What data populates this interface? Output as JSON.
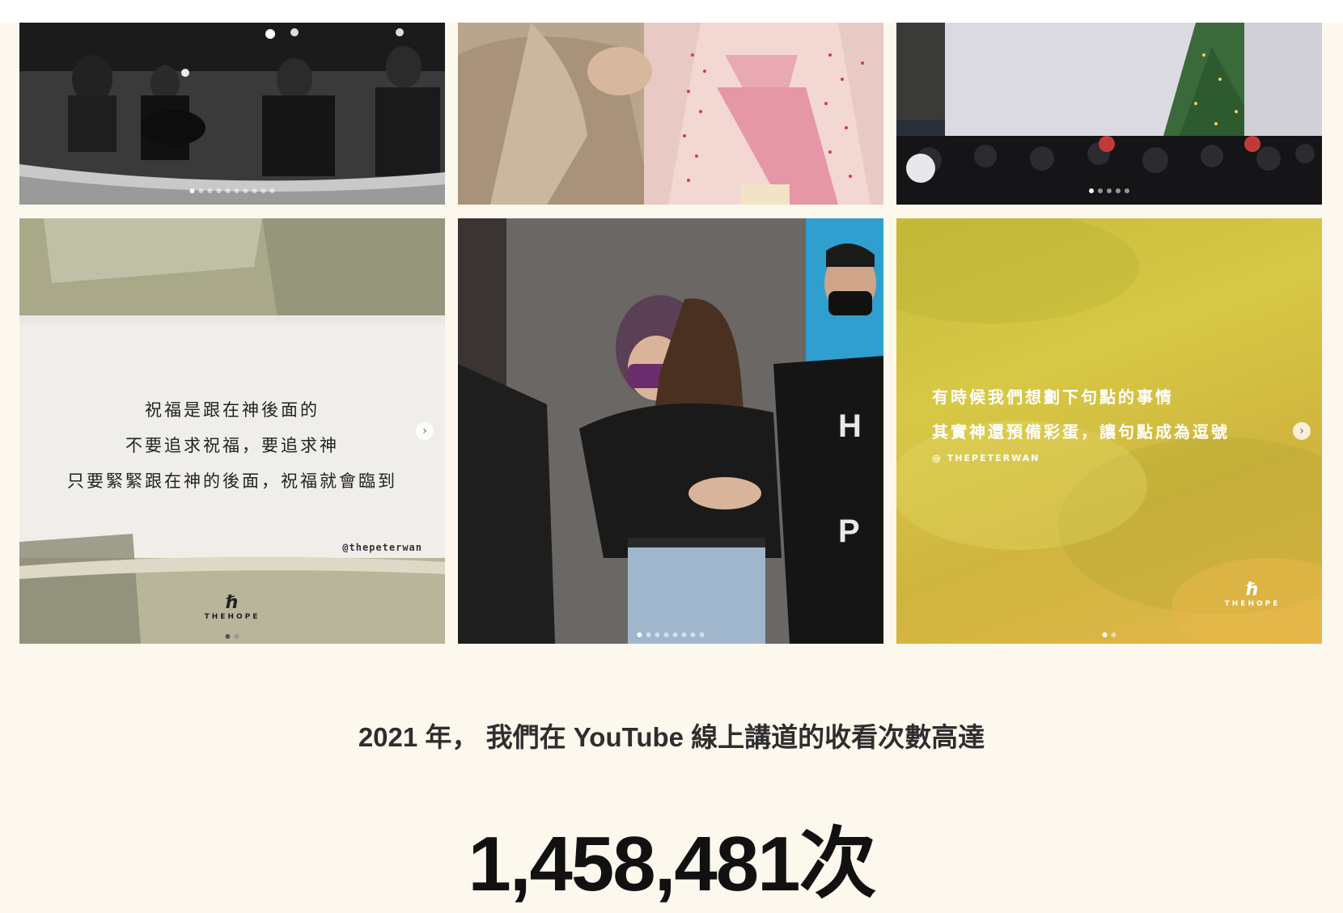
{
  "gallery": {
    "tile1": {
      "dots_total": 10,
      "dots_active": 0
    },
    "tile2": {},
    "tile3": {
      "dots_total": 5,
      "dots_active": 0
    },
    "tile4": {
      "quote_lines": [
        "祝福是跟在神後面的",
        "不要追求祝福，要追求神",
        "只要緊緊跟在神的後面，祝福就會臨到"
      ],
      "handle": "@thepeterwan",
      "logo_text": "THEHOPE",
      "arrow": "›",
      "dots_total": 2,
      "dots_active": 0
    },
    "tile5": {
      "dots_total": 8,
      "dots_active": 0
    },
    "tile6": {
      "quote_lines": [
        "有時候我們想劃下句點的事情",
        "其實神還預備彩蛋，讓句點成為逗號"
      ],
      "handle": "@ THEPETERWAN",
      "logo_text": "THEHOPE",
      "arrow": "›",
      "dots_total": 2,
      "dots_active": 0
    }
  },
  "stats": {
    "heading": "2021 年， 我們在 YouTube 線上講道的收看次數高達",
    "value": "1,458,481次"
  }
}
